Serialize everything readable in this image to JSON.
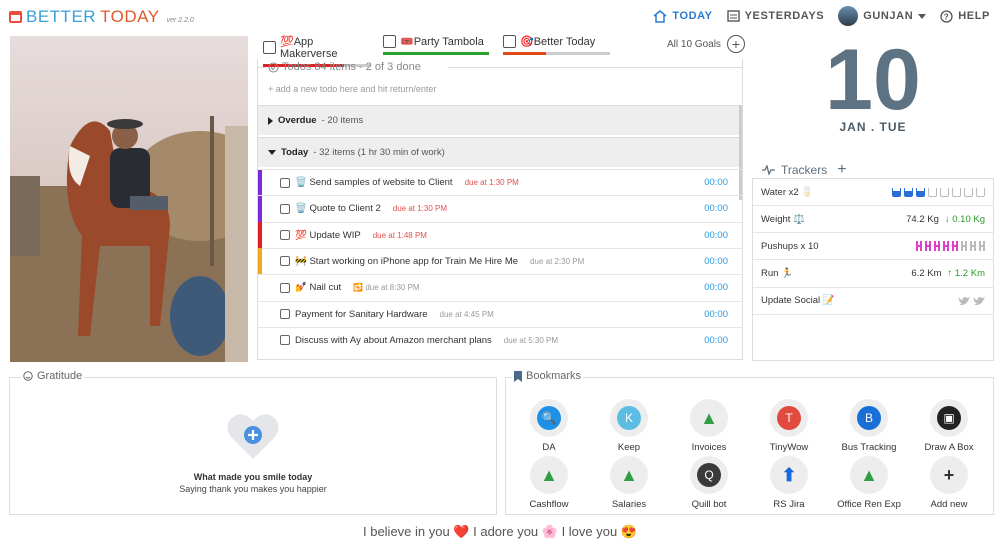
{
  "header": {
    "brand_a": "BETTER",
    "brand_b": "TODAY",
    "version": "ver 2.2.0",
    "nav": [
      {
        "label": "TODAY"
      },
      {
        "label": "YESTERDAYS"
      },
      {
        "label": "GUNJAN"
      },
      {
        "label": "HELP"
      }
    ]
  },
  "goals": [
    {
      "label": "💯App Makerverse",
      "progress": 0.75,
      "color": "#e02020"
    },
    {
      "label": "🎟️Party Tambola",
      "progress": 1.0,
      "color": "#2aa02a"
    },
    {
      "label": "🎯Better Today",
      "progress": 0.4,
      "color": "#e24a1a"
    }
  ],
  "all_goals_label": "All 10 Goals",
  "todos": {
    "title": "Todos 84 items - 2 of 3 done",
    "add_placeholder": "+ add a new todo here and hit return/enter",
    "overdue": {
      "label": "Overdue",
      "count": "- 20 items"
    },
    "today": {
      "label": "Today",
      "count": "- 32 items (1 hr 30 min of work)"
    },
    "items": [
      {
        "text": "🗑️ Send samples of website to Client",
        "due": "due at 1:30 PM",
        "due_color": "#e05050",
        "time": "00:00",
        "strip": "#7a2ad6"
      },
      {
        "text": "🗑️ Quote to Client 2",
        "due": "due at 1:30 PM",
        "due_color": "#e05050",
        "time": "00:00",
        "strip": "#7a2ad6"
      },
      {
        "text": "💯 Update WIP",
        "due": "due at 1:48 PM",
        "due_color": "#e05050",
        "time": "00:00",
        "strip": "#e02020"
      },
      {
        "text": "🚧 Start working on iPhone app for Train Me Hire Me",
        "due": "due at 2:30 PM",
        "due_color": "#999",
        "time": "00:00",
        "strip": "#f2a820"
      },
      {
        "text": "💅 Nail cut",
        "due": "🔁 due at 8:30 PM",
        "due_color": "#999",
        "time": "00:00",
        "strip": "transparent"
      },
      {
        "text": "Payment for Sanitary Hardware",
        "due": "due at 4:45 PM",
        "due_color": "#999",
        "time": "00:00",
        "strip": "transparent"
      },
      {
        "text": "Discuss with Ay about Amazon merchant plans",
        "due": "due at 5:30 PM",
        "due_color": "#999",
        "time": "00:00",
        "strip": "transparent"
      }
    ]
  },
  "date": {
    "day": "10",
    "month_day": "JAN . TUE"
  },
  "trackers": {
    "title": "Trackers",
    "rows": [
      {
        "label": "Water x2 🥛",
        "value": "",
        "delta": "",
        "filled": 3,
        "total": 8,
        "kind": "cup"
      },
      {
        "label": "Weight ⚖️",
        "value": "74.2 Kg",
        "delta": "↓ 0.10 Kg",
        "kind": "text"
      },
      {
        "label": "Pushups x 10",
        "value": "",
        "delta": "",
        "filled": 5,
        "total": 8,
        "kind": "dumb"
      },
      {
        "label": "Run 🏃",
        "value": "6.2 Km",
        "delta": "↑ 1.2 Km",
        "kind": "text"
      },
      {
        "label": "Update Social 📝",
        "value": "",
        "delta": "",
        "kind": "social"
      }
    ]
  },
  "gratitude": {
    "title": "Gratitude",
    "line1": "What made you smile today",
    "line2": "Saying thank you makes you happier"
  },
  "bookmarks": {
    "title": "Bookmarks",
    "items": [
      {
        "label": "DA",
        "glyph": "🔍",
        "fg": "#ffffff",
        "bg": "#1e90e8"
      },
      {
        "label": "Keep",
        "glyph": "K",
        "fg": "#ffffff",
        "bg": "#5bbce4"
      },
      {
        "label": "Invoices",
        "glyph": "▲",
        "fg": "#2f9e44",
        "bg": "#ededed"
      },
      {
        "label": "TinyWow",
        "glyph": "T",
        "fg": "#ffffff",
        "bg": "#e04a3f"
      },
      {
        "label": "Bus Tracking",
        "glyph": "B",
        "fg": "#ffffff",
        "bg": "#1a6fd6"
      },
      {
        "label": "Draw A Box",
        "glyph": "▣",
        "fg": "#ffffff",
        "bg": "#222222"
      },
      {
        "label": "Cashflow",
        "glyph": "▲",
        "fg": "#2f9e44",
        "bg": "#ededed"
      },
      {
        "label": "Salaries",
        "glyph": "▲",
        "fg": "#2f9e44",
        "bg": "#ededed"
      },
      {
        "label": "Quill bot",
        "glyph": "Q",
        "fg": "#ffffff",
        "bg": "#3a3a3a"
      },
      {
        "label": "RS Jira",
        "glyph": "⬆",
        "fg": "#1868db",
        "bg": "#ededed"
      },
      {
        "label": "Office Ren Exp",
        "glyph": "▲",
        "fg": "#2f9e44",
        "bg": "#ededed"
      },
      {
        "label": "Add new",
        "glyph": "+",
        "fg": "#333333",
        "bg": "#ededed"
      }
    ]
  },
  "footer": "I believe in you ❤️ I adore you 🌸 I love you 😍"
}
